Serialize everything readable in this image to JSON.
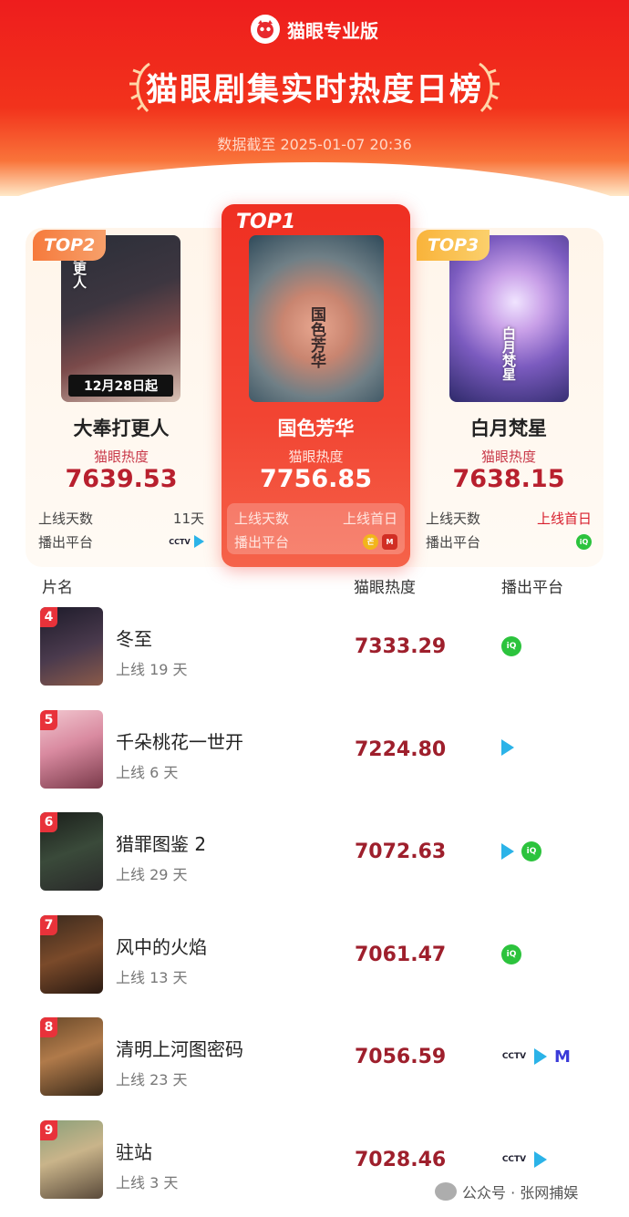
{
  "header": {
    "brand": "猫眼专业版",
    "title": "猫眼剧集实时热度日榜",
    "updated": "数据截至 2025-01-07 20:36"
  },
  "labels": {
    "heat": "猫眼热度",
    "days_online": "上线天数",
    "platform": "播出平台"
  },
  "podium": [
    {
      "rank": "TOP2",
      "title": "大奉打更人",
      "heat": "7639.53",
      "days": "11天",
      "poster_date": "12月28日起",
      "poster_text": "打更人",
      "platforms": [
        "cctv",
        "tencent"
      ]
    },
    {
      "rank": "TOP1",
      "title": "国色芳华",
      "heat": "7756.85",
      "days": "上线首日",
      "poster_text": "国色芳华",
      "platforms": [
        "mango",
        "mgtv"
      ]
    },
    {
      "rank": "TOP3",
      "title": "白月梵星",
      "heat": "7638.15",
      "days": "上线首日",
      "poster_text": "白月梵星",
      "platforms": [
        "iqiyi"
      ]
    }
  ],
  "list_header": {
    "name": "片名",
    "heat": "猫眼热度",
    "platform": "播出平台"
  },
  "list": [
    {
      "rank": "4",
      "title": "冬至",
      "days": "上线 19 天",
      "heat": "7333.29",
      "platforms": [
        "iqiyi"
      ]
    },
    {
      "rank": "5",
      "title": "千朵桃花一世开",
      "days": "上线 6 天",
      "heat": "7224.80",
      "platforms": [
        "tencent"
      ]
    },
    {
      "rank": "6",
      "title": "猎罪图鉴 2",
      "days": "上线 29 天",
      "heat": "7072.63",
      "platforms": [
        "tencent",
        "iqiyi"
      ]
    },
    {
      "rank": "7",
      "title": "风中的火焰",
      "days": "上线 13 天",
      "heat": "7061.47",
      "platforms": [
        "iqiyi"
      ]
    },
    {
      "rank": "8",
      "title": "清明上河图密码",
      "days": "上线 23 天",
      "heat": "7056.59",
      "platforms": [
        "cctv",
        "tencent",
        "migu"
      ]
    },
    {
      "rank": "9",
      "title": "驻站",
      "days": "上线 3 天",
      "heat": "7028.46",
      "platforms": [
        "cctv",
        "tencent"
      ]
    }
  ],
  "watermark": "公众号 · 张网捕娱",
  "colors": {
    "header_red": "#ee1d1d",
    "heat_red": "#b8202e",
    "rank_badge": "#e8323a",
    "top2_tag": "#f67a3c",
    "top3_tag": "#f9b33a"
  },
  "icons": [
    "maoyan-logo-icon",
    "laurel-icon",
    "iqiyi-icon",
    "tencent-video-icon",
    "cctv-icon",
    "mango-tv-icon",
    "migu-icon"
  ]
}
